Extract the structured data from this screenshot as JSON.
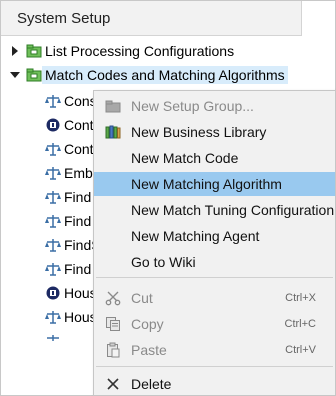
{
  "panel": {
    "title": "System Setup"
  },
  "tree": {
    "items": [
      {
        "label": "List Processing Configurations"
      },
      {
        "label": "Match Codes and Matching Algorithms"
      },
      {
        "label": "Cons"
      },
      {
        "label": "Cont"
      },
      {
        "label": "Cont"
      },
      {
        "label": "Embe"
      },
      {
        "label": "Find"
      },
      {
        "label": "Find"
      },
      {
        "label": "FindS"
      },
      {
        "label": "Find"
      },
      {
        "label": "Hous"
      },
      {
        "label": "Hous"
      }
    ]
  },
  "menu": {
    "items": [
      {
        "label": "New Setup Group...",
        "icon": "folder-icon",
        "enabled": false
      },
      {
        "label": "New Business Library",
        "icon": "books-icon",
        "enabled": true
      },
      {
        "label": "New Match Code",
        "enabled": true
      },
      {
        "label": "New Matching Algorithm",
        "enabled": true,
        "selected": true
      },
      {
        "label": "New Match Tuning Configuration",
        "enabled": true
      },
      {
        "label": "New Matching Agent",
        "enabled": true
      },
      {
        "label": "Go to Wiki",
        "enabled": true
      },
      {
        "label": "Cut",
        "icon": "cut-icon",
        "shortcut": "Ctrl+X",
        "enabled": false
      },
      {
        "label": "Copy",
        "icon": "copy-icon",
        "shortcut": "Ctrl+C",
        "enabled": false
      },
      {
        "label": "Paste",
        "icon": "paste-icon",
        "shortcut": "Ctrl+V",
        "enabled": false
      },
      {
        "label": "Delete",
        "icon": "delete-icon",
        "enabled": true
      }
    ]
  },
  "colors": {
    "selection": "#99c9ef",
    "tree_highlight": "#d8ecfb",
    "menu_background": "#f1f1f1"
  }
}
